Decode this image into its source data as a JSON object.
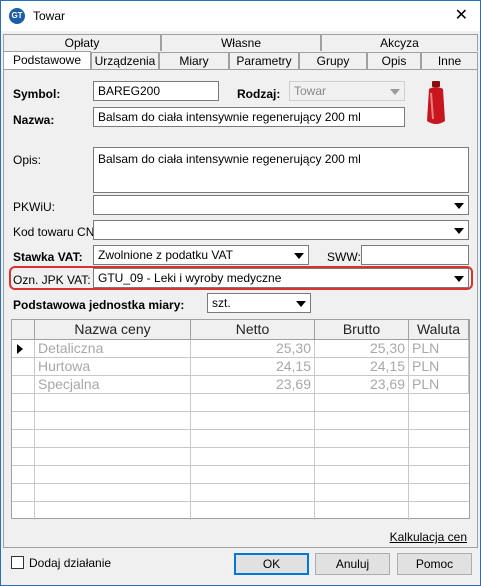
{
  "window": {
    "title": "Towar",
    "app_icon": "app-logo-icon"
  },
  "tabs_row1": [
    {
      "label": "Opłaty"
    },
    {
      "label": "Własne"
    },
    {
      "label": "Akcyza"
    }
  ],
  "tabs_row2": [
    {
      "label": "Podstawowe",
      "active": true
    },
    {
      "label": "Urządzenia"
    },
    {
      "label": "Miary"
    },
    {
      "label": "Parametry"
    },
    {
      "label": "Grupy"
    },
    {
      "label": "Opis"
    },
    {
      "label": "Inne"
    }
  ],
  "form": {
    "symbol_label": "Symbol:",
    "symbol_value": "BAREG200",
    "rodzaj_label": "Rodzaj:",
    "rodzaj_value": "Towar",
    "nazwa_label": "Nazwa:",
    "nazwa_value": "Balsam do ciała intensywnie regenerujący 200 ml",
    "opis_label": "Opis:",
    "opis_value": "Balsam do ciała intensywnie regenerujący 200 ml",
    "pkwiu_label": "PKWiU:",
    "pkwiu_value": "",
    "kod_cn_label": "Kod towaru CN:",
    "kod_cn_value": "",
    "stawka_label": "Stawka VAT:",
    "stawka_value": "Zwolnione z podatku VAT",
    "sww_label": "SWW:",
    "sww_value": "",
    "jpk_label": "Ozn. JPK VAT:",
    "jpk_value": "GTU_09 - Leki i wyroby medyczne",
    "jednostka_label": "Podstawowa jednostka miary:",
    "jednostka_value": "szt."
  },
  "price_table": {
    "columns": [
      "Nazwa ceny",
      "Netto",
      "Brutto",
      "Waluta"
    ],
    "rows": [
      [
        "Detaliczna",
        "25,30",
        "25,30",
        "PLN"
      ],
      [
        "Hurtowa",
        "24,15",
        "24,15",
        "PLN"
      ],
      [
        "Specjalna",
        "23,69",
        "23,69",
        "PLN"
      ]
    ]
  },
  "links": {
    "kalkulacja": "Kalkulacja cen"
  },
  "footer": {
    "dodaj_label": "Dodaj działanie",
    "ok_label": "OK",
    "anuluj_label": "Anuluj",
    "pomoc_label": "Pomoc"
  }
}
